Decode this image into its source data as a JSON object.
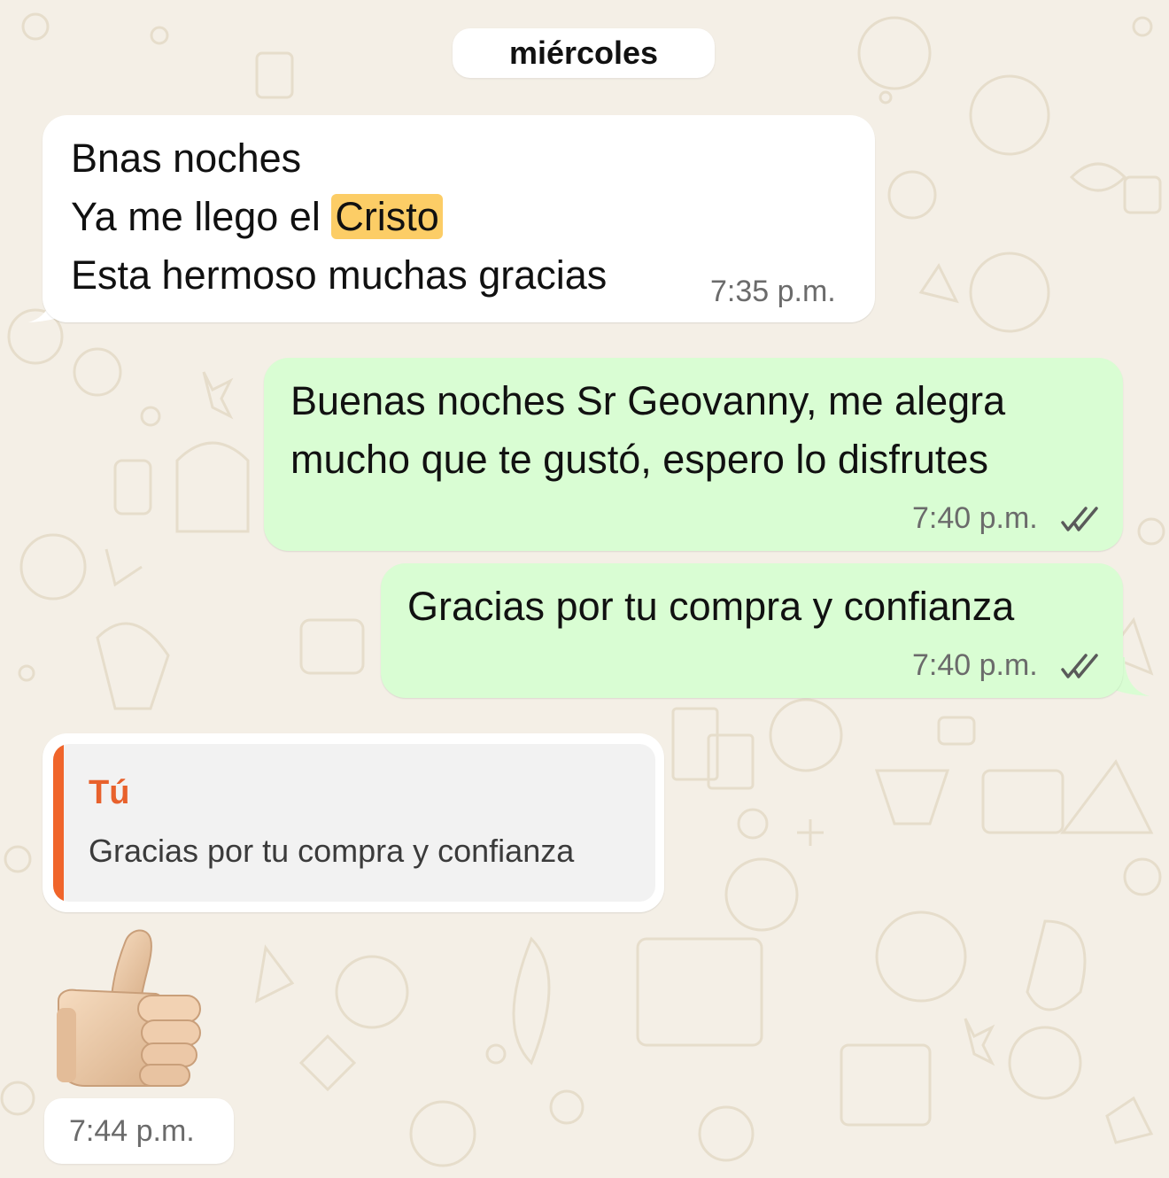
{
  "date_separator": "miércoles",
  "messages": [
    {
      "direction": "incoming",
      "line1": "Bnas noches",
      "line2_prefix": "Ya me llego el ",
      "line2_highlight": "Cristo",
      "line3": "Esta hermoso muchas gracias",
      "time": "7:35 p.m."
    },
    {
      "direction": "outgoing",
      "line1": "Buenas noches Sr Geovanny, me alegra",
      "line2": "mucho que te gustó, espero lo disfrutes",
      "time": "7:40 p.m.",
      "status": "read"
    },
    {
      "direction": "outgoing",
      "line1": "Gracias por tu compra y confianza",
      "time": "7:40 p.m.",
      "status": "read"
    },
    {
      "direction": "incoming",
      "quote_author": "Tú",
      "quote_text": "Gracias por tu compra y confianza",
      "sticker": "thumbs-up-emoji",
      "time": "7:44 p.m."
    }
  ],
  "colors": {
    "background": "#f4efe6",
    "incoming_bubble": "#ffffff",
    "outgoing_bubble": "#d9fdd3",
    "highlight": "#fccd66",
    "quote_accent": "#f0652b",
    "timestamp": "#6b6b6b"
  }
}
